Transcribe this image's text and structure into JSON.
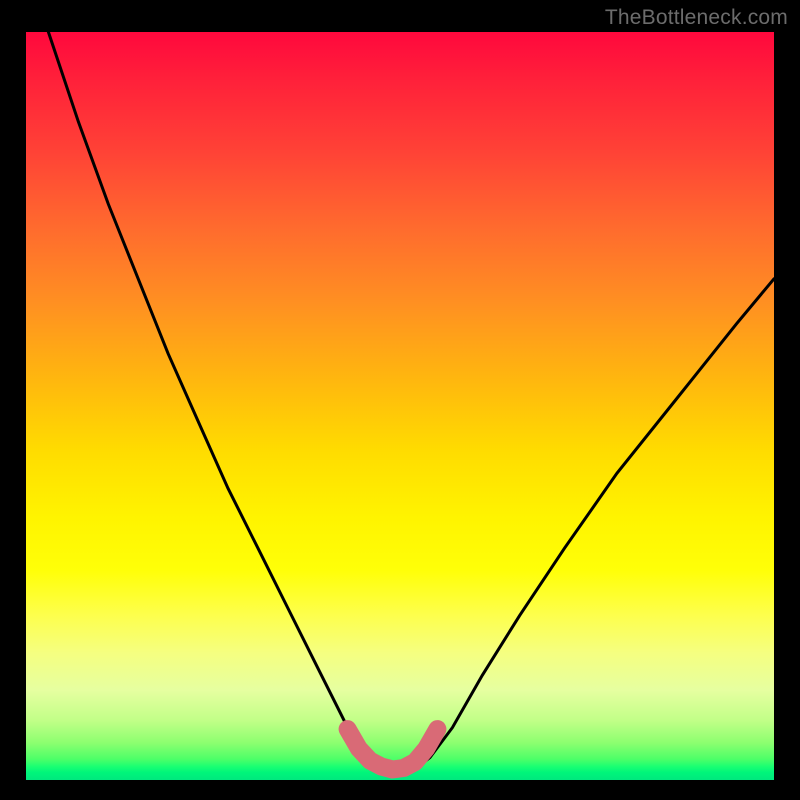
{
  "watermark": "TheBottleneck.com",
  "colors": {
    "frame": "#000000",
    "curve": "#000000",
    "highlight": "#d96a76",
    "gradient_top": "#ff083d",
    "gradient_bottom": "#00e87e"
  },
  "chart_data": {
    "type": "line",
    "title": "",
    "xlabel": "",
    "ylabel": "",
    "xlim": [
      0,
      100
    ],
    "ylim": [
      0,
      100
    ],
    "grid": false,
    "series": [
      {
        "name": "bottleneck-curve",
        "x": [
          3,
          7,
          11,
          15,
          19,
          23,
          27,
          31,
          35,
          39,
          42,
          44,
          46,
          48,
          50,
          52,
          54,
          57,
          61,
          66,
          72,
          79,
          87,
          95,
          100
        ],
        "values": [
          100,
          88,
          77,
          67,
          57,
          48,
          39,
          31,
          23,
          15,
          9,
          5,
          3,
          1.5,
          1.2,
          1.5,
          3,
          7,
          14,
          22,
          31,
          41,
          51,
          61,
          67
        ]
      }
    ],
    "annotations": [
      {
        "name": "optimal-range-highlight",
        "x": [
          43.0,
          44.5,
          46.0,
          47.5,
          49.0,
          50.5,
          52.0,
          53.5,
          55.0
        ],
        "y": [
          6.8,
          4.2,
          2.6,
          1.8,
          1.4,
          1.6,
          2.4,
          4.2,
          6.8
        ],
        "style": "thick-rounded"
      }
    ]
  }
}
